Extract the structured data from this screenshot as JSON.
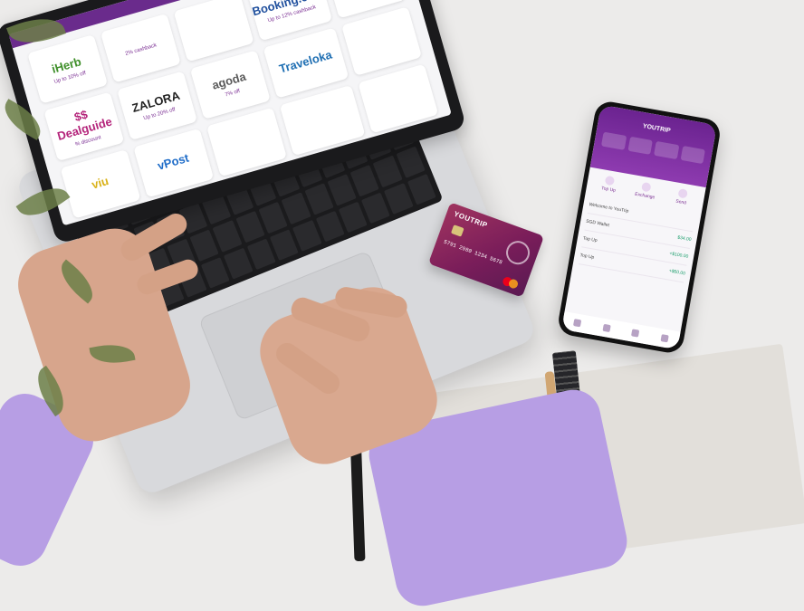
{
  "laptop": {
    "partners": [
      {
        "logo": "iHerb",
        "deal": "Up to 10% off",
        "color": "#3f8f2a"
      },
      {
        "logo": "",
        "deal": "2% cashback",
        "color": "#e54a3c"
      },
      {
        "logo": "",
        "deal": "",
        "color": "#888888"
      },
      {
        "logo": "Booking.com",
        "deal": "Up to 12% cashback",
        "color": "#1f4f9d"
      },
      {
        "logo": "",
        "deal": "",
        "color": "#888888"
      },
      {
        "logo": "$$ Dealguide",
        "deal": "% discount",
        "color": "#b4237a"
      },
      {
        "logo": "ZALORA",
        "deal": "Up to 20% off",
        "color": "#222222"
      },
      {
        "logo": "agoda",
        "deal": "7% off",
        "color": "#5a5a5a"
      },
      {
        "logo": "Traveloka",
        "deal": "",
        "color": "#1f6fb3"
      },
      {
        "logo": "",
        "deal": "",
        "color": "#888888"
      },
      {
        "logo": "viu",
        "deal": "",
        "color": "#d9b21a"
      },
      {
        "logo": "vPost",
        "deal": "",
        "color": "#1e6cc8"
      },
      {
        "logo": "",
        "deal": "",
        "color": "#888888"
      },
      {
        "logo": "",
        "deal": "",
        "color": "#888888"
      },
      {
        "logo": "",
        "deal": "",
        "color": "#888888"
      }
    ]
  },
  "card": {
    "brand": "YOUTRIP",
    "number": "5791 2980 1234 5678",
    "color_primary": "#7a1d5a"
  },
  "phone": {
    "title": "YOUTRIP",
    "actions": [
      "Top Up",
      "Exchange",
      "Send"
    ],
    "rows": [
      {
        "label": "Welcome to YouTrip",
        "amount": ""
      },
      {
        "label": "SGD Wallet",
        "amount": "$34.00"
      },
      {
        "label": "Top Up",
        "amount": "+$100.00"
      },
      {
        "label": "Top Up",
        "amount": "+$50.00"
      }
    ]
  },
  "colors": {
    "accent": "#6b2390",
    "sleeve": "#b79ee4",
    "background": "#ecebea"
  }
}
